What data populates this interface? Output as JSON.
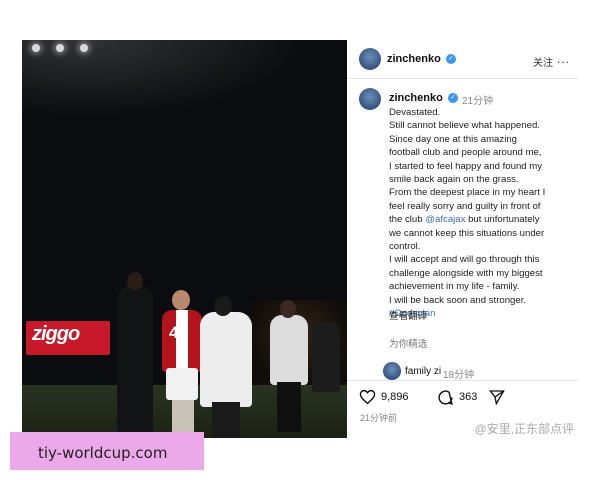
{
  "post": {
    "username": "zinchenko",
    "follow_label": "关注",
    "more_label": "...",
    "caption_time": "21分钟",
    "caption_lines": [
      "Devastated.",
      "Still cannot believe what happened.",
      "Since day one at this amazing",
      "football club and people around me,",
      "I started to feel happy and found my",
      "smile back again on the grass.",
      "From the deepest place in my heart I",
      "feel really sorry and guilty in front of",
      "the club ",
      "we cannot keep this situations under",
      "control.",
      "I will accept and will go through this",
      "challenge alongside with my biggest",
      "achievement in my life - family.",
      "I will be back soon and stronger."
    ],
    "mention": "@afcajax",
    "mention_suffix": " but unfortunately",
    "hashtag": "#Godsplan",
    "translate_label": "查看翻译",
    "replies_label": "为你精选",
    "comment": {
      "user": "family zi",
      "time": "18分钟"
    },
    "likes": "9,896",
    "comments_count": "363",
    "posted_time": "21分钟前",
    "watermark": "@安里,正东部点评"
  },
  "photo": {
    "ad_text": "ziggo",
    "jersey_number": "47"
  },
  "banner": {
    "text": "tiy-worldcup.com"
  },
  "colors": {
    "accent": "#3897f0",
    "link": "#3d6fb6",
    "banner_bg": "#eba9ea"
  }
}
